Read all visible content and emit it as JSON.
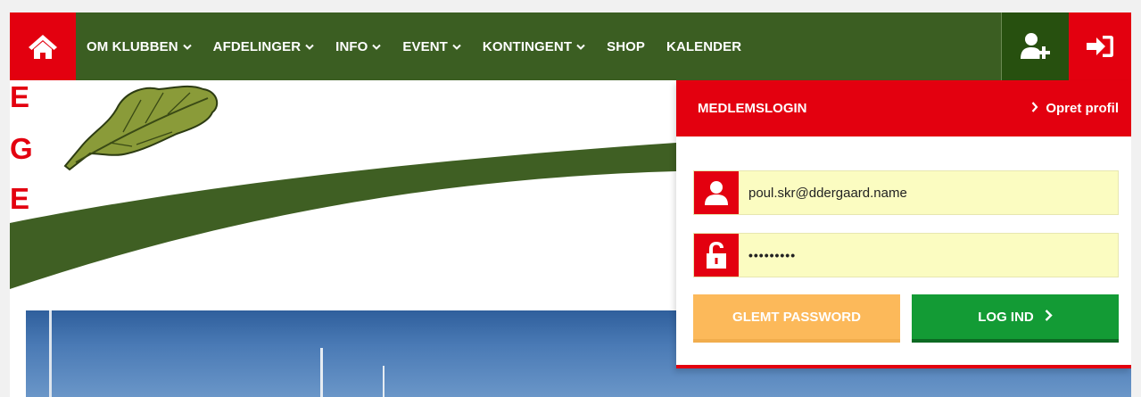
{
  "nav": {
    "items": [
      {
        "label": "OM KLUBBEN",
        "dropdown": true
      },
      {
        "label": "AFDELINGER",
        "dropdown": true
      },
      {
        "label": "INFO",
        "dropdown": true
      },
      {
        "label": "EVENT",
        "dropdown": true
      },
      {
        "label": "KONTINGENT",
        "dropdown": true
      },
      {
        "label": "SHOP",
        "dropdown": false
      },
      {
        "label": "KALENDER",
        "dropdown": false
      }
    ],
    "icons": {
      "home": "home-icon",
      "add_user": "user-plus-icon",
      "login": "sign-in-icon"
    }
  },
  "logo": {
    "letters": [
      "E",
      "G",
      "E"
    ]
  },
  "login": {
    "title": "MEDLEMSLOGIN",
    "create_profile": "Opret profil",
    "email_value": "poul.skr@ddergaard.name",
    "password_value": "•••••••••",
    "forgot_label": "GLEMT PASSWORD",
    "login_label": "LOG IND"
  },
  "colors": {
    "brand_red": "#e3000f",
    "nav_green": "#3b5e22",
    "dark_green": "#27500f",
    "button_green": "#139b35",
    "button_orange": "#fcb95a",
    "field_yellow": "#fbfcc1"
  }
}
